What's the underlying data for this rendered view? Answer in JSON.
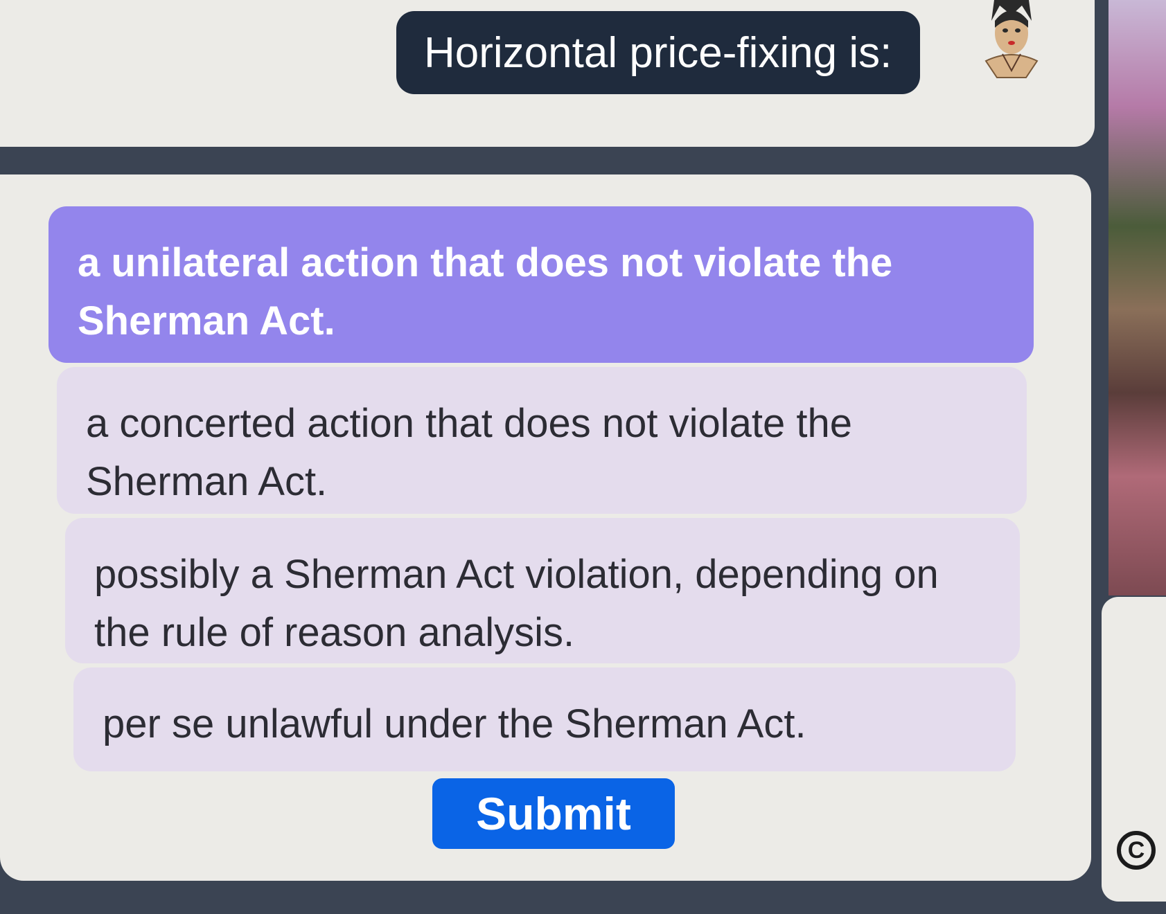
{
  "question": {
    "text": "Horizontal price-fixing is:"
  },
  "options": [
    {
      "label": "a unilateral action that does not violate the Sherman Act.",
      "selected": true
    },
    {
      "label": "a concerted action that does not violate the Sherman Act.",
      "selected": false
    },
    {
      "label": "possibly a Sherman Act violation, depending on the rule of reason analysis.",
      "selected": false
    },
    {
      "label": "per se unlawful under the Sherman Act.",
      "selected": false
    }
  ],
  "submit": {
    "label": "Submit"
  },
  "icons": {
    "avatar": "avatar-icon",
    "copyright": "copyright-icon"
  },
  "colors": {
    "question_bubble": "#1f2b3d",
    "selected_option": "#9385ec",
    "option_background": "#e4dced",
    "submit_button": "#0a64e6",
    "panel_background": "#ecebe7"
  }
}
